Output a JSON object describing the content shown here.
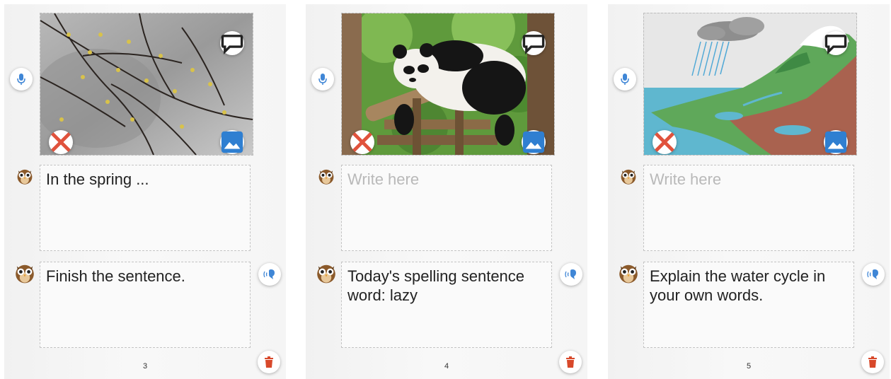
{
  "pages": [
    {
      "number": "3",
      "image": "spring-branches-photo",
      "answer_text": "In the spring ...",
      "answer_is_placeholder": false,
      "prompt_text": "Finish the sentence."
    },
    {
      "number": "4",
      "image": "panda-photo",
      "answer_text": "Write here",
      "answer_is_placeholder": true,
      "prompt_text": "Today's spelling sentence word: lazy"
    },
    {
      "number": "5",
      "image": "water-cycle-drawing",
      "answer_text": "Write here",
      "answer_is_placeholder": true,
      "prompt_text": "Explain the water cycle in your own words."
    }
  ],
  "icons": {
    "speech": "speech-bubble-icon",
    "remove": "close-icon",
    "image": "image-icon",
    "mic": "microphone-icon",
    "audio": "speaker-voice-icon",
    "trash": "trash-icon",
    "avatar": "owl-icon"
  },
  "colors": {
    "remove_icon": "#e0523c",
    "image_icon": "#2f7fd1",
    "mic_icon": "#3f86d6",
    "trash_icon": "#d8482a",
    "placeholder_text": "#b9b9b9",
    "owl_brown": "#8b5a2b"
  }
}
